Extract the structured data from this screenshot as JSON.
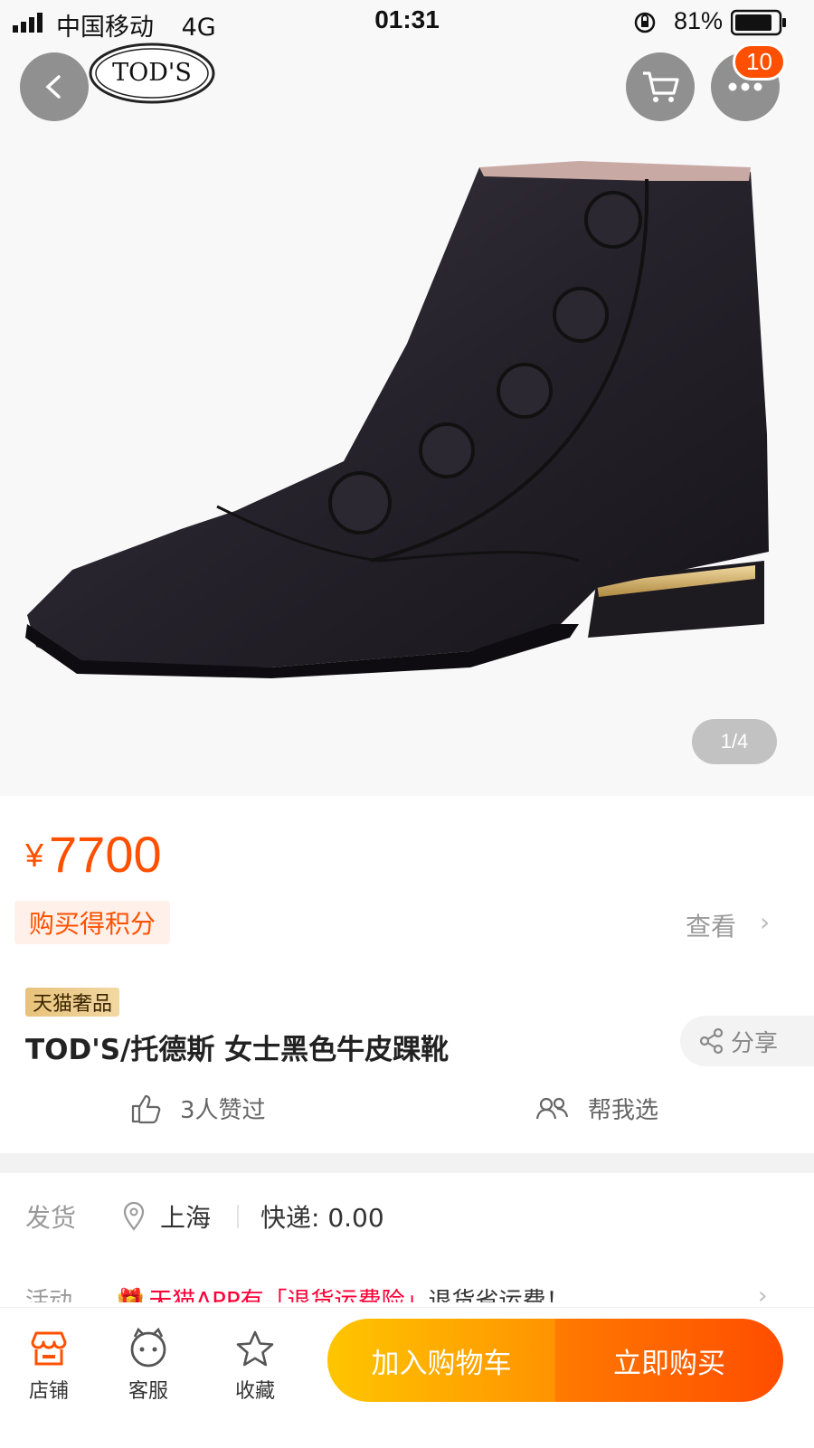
{
  "status_bar": {
    "carrier": "中国移动",
    "network": "4G",
    "time": "01:31",
    "battery": "81%"
  },
  "header": {
    "brand_logo_text": "TOD'S",
    "cart_badge_count": "10"
  },
  "gallery": {
    "pager": "1/4"
  },
  "price": {
    "currency": "¥",
    "amount": "7700"
  },
  "points": {
    "label": "购买得积分",
    "view_label": "查看",
    "chevron": "›"
  },
  "product": {
    "tag": "天猫奢品",
    "title": "TOD'S/托德斯 女士黑色牛皮踝靴",
    "share_label": "分享"
  },
  "social": {
    "likes_text": "3人赞过",
    "help_text": "帮我选"
  },
  "shipping": {
    "label": "发货",
    "city": "上海",
    "fee": "快递: 0.00"
  },
  "activity": {
    "label": "活动",
    "promo_red": "天猫APP有「退货运费险」",
    "promo_rest": "退货省运费！",
    "chevron": "›"
  },
  "bottom_bar": {
    "store_label": "店铺",
    "service_label": "客服",
    "favorite_label": "收藏",
    "add_to_cart_label": "加入购物车",
    "buy_now_label": "立即购买"
  },
  "colors": {
    "accent_orange": "#ff5000",
    "cart_button": "#ffa200",
    "buy_button": "#ff5a00"
  }
}
